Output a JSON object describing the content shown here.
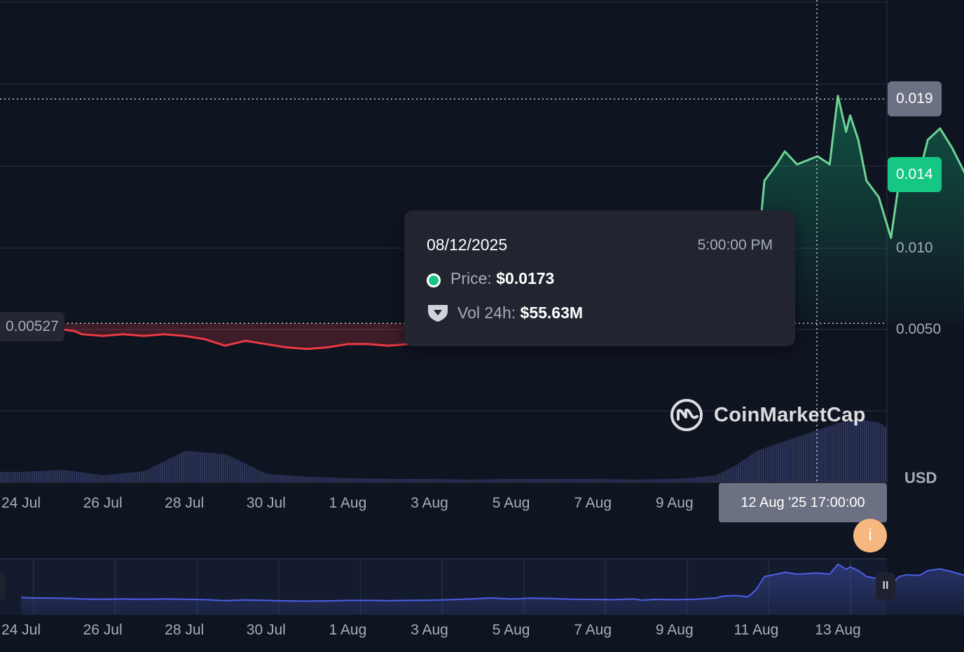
{
  "chart_data": {
    "type": "area",
    "x_axis_labels": [
      "24 Jul",
      "26 Jul",
      "28 Jul",
      "30 Jul",
      "1 Aug",
      "3 Aug",
      "5 Aug",
      "7 Aug",
      "9 Aug"
    ],
    "navigator_labels": [
      "24 Jul",
      "26 Jul",
      "28 Jul",
      "30 Jul",
      "1 Aug",
      "3 Aug",
      "5 Aug",
      "7 Aug",
      "9 Aug",
      "11 Aug",
      "13 Aug"
    ],
    "y_axis_labels": [
      "0.010",
      "0.0050"
    ],
    "y_unit": "USD",
    "ylim": [
      0,
      0.022
    ],
    "baseline": "0.00527",
    "current_price": "0.014",
    "crosshair_price": "0.019",
    "crosshair_time": "12 Aug '25 17:00:00",
    "series": [
      {
        "name": "Price",
        "x_days": [
          0,
          0.2,
          0.5,
          1,
          1.3,
          1.5,
          2,
          2.5,
          3,
          3.5,
          4,
          4.5,
          5,
          5.5,
          6,
          6.5,
          7,
          7.5,
          8,
          8.5,
          9,
          9.5,
          10,
          10.5,
          11,
          11.5,
          12,
          12.5,
          13,
          13.5,
          14,
          14.5,
          15,
          15.2,
          15.5,
          16,
          16.5,
          17,
          17.2,
          17.5,
          17.8,
          18,
          18.2,
          18.5,
          18.7,
          19,
          19.5,
          19.8,
          20,
          20.2,
          20.3,
          20.5,
          20.7,
          21,
          21.3,
          21.5,
          21.7,
          22,
          22.2,
          22.5,
          22.8,
          23,
          23.3,
          23.5,
          23.7,
          23.9,
          24
        ],
        "price": [
          0.0052,
          0.0051,
          0.005,
          0.0049,
          0.0048,
          0.0046,
          0.0045,
          0.0046,
          0.0045,
          0.0046,
          0.0045,
          0.0043,
          0.0039,
          0.0042,
          0.004,
          0.0038,
          0.0037,
          0.0038,
          0.004,
          0.004,
          0.0039,
          0.004,
          0.0041,
          0.0043,
          0.0046,
          0.005,
          0.0046,
          0.0049,
          0.0048,
          0.0045,
          0.0044,
          0.0043,
          0.0046,
          0.0041,
          0.0044,
          0.0043,
          0.0045,
          0.005,
          0.0058,
          0.006,
          0.0055,
          0.0085,
          0.014,
          0.015,
          0.0158,
          0.015,
          0.0155,
          0.015,
          0.0192,
          0.017,
          0.018,
          0.0165,
          0.014,
          0.013,
          0.0105,
          0.014,
          0.0148,
          0.0145,
          0.0165,
          0.0172,
          0.016,
          0.015,
          0.0135,
          0.014,
          0.0138,
          0.014,
          0.014
        ]
      },
      {
        "name": "Vol 24h",
        "x_days": [
          0,
          1,
          2,
          3,
          4,
          5,
          6,
          7,
          8,
          9,
          10,
          11,
          12,
          13,
          14,
          15,
          16,
          16.5,
          17,
          17.5,
          18,
          18.5,
          19,
          19.5,
          20,
          20.5,
          21,
          21.5,
          22,
          22.5,
          23,
          23.5,
          24
        ],
        "volume": [
          0.15,
          0.18,
          0.1,
          0.16,
          0.45,
          0.4,
          0.12,
          0.08,
          0.06,
          0.05,
          0.05,
          0.04,
          0.05,
          0.05,
          0.05,
          0.04,
          0.05,
          0.07,
          0.1,
          0.25,
          0.45,
          0.55,
          0.65,
          0.75,
          0.85,
          0.9,
          0.85,
          0.65,
          0.5,
          0.7,
          0.85,
          0.92,
          0.95
        ]
      }
    ]
  },
  "tooltip": {
    "date": "08/12/2025",
    "time": "5:00:00 PM",
    "price_label": "Price:",
    "price_value": "$0.0173",
    "vol_label": "Vol 24h:",
    "vol_value": "$55.63M"
  },
  "watermark": "CoinMarketCap",
  "colors": {
    "background": "#0f1421",
    "up": "#16c784",
    "down": "#ea3943",
    "volume": "#2b3357",
    "navigator_line": "#4c5ee8"
  },
  "icons": {
    "info": "i",
    "pause": "II"
  }
}
